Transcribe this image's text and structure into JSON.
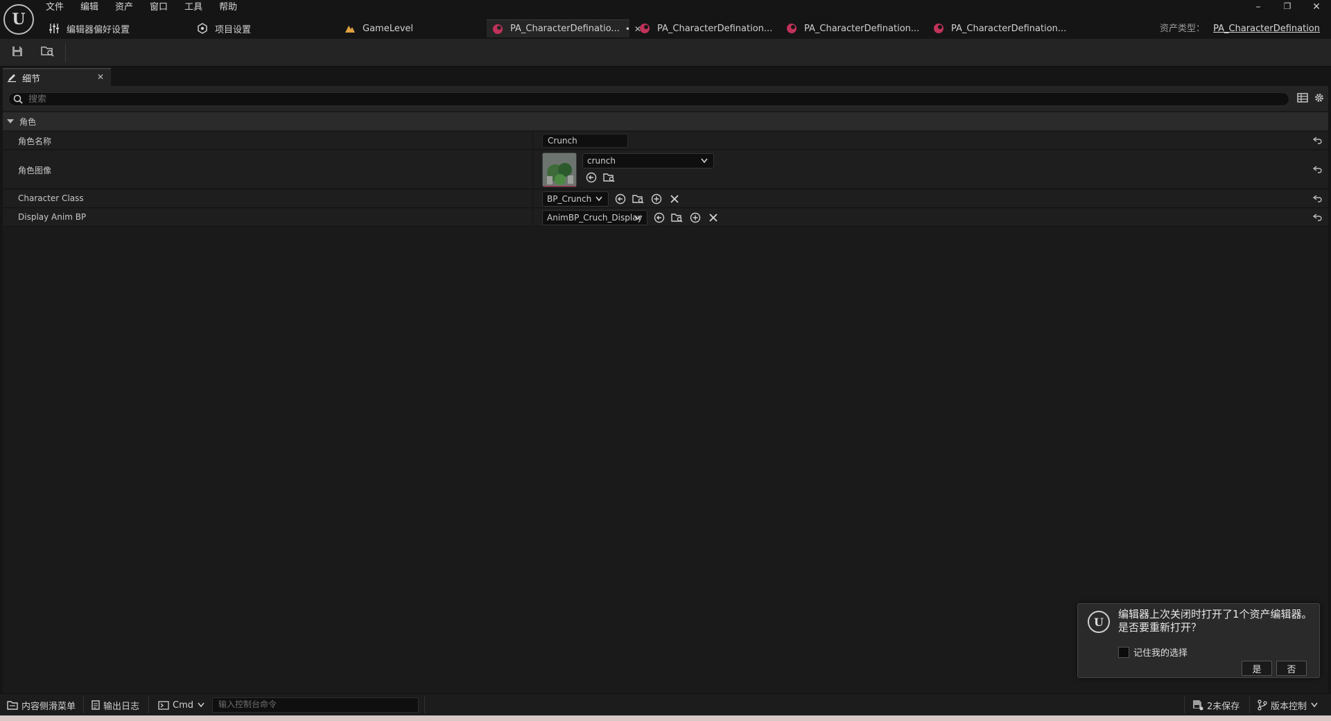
{
  "menu": [
    "文件",
    "编辑",
    "资产",
    "窗口",
    "工具",
    "帮助"
  ],
  "logo_letter": "U",
  "tabs": [
    {
      "label": "编辑器偏好设置",
      "icon": "sliders-icon"
    },
    {
      "label": "项目设置",
      "icon": "settings-cube-icon"
    },
    {
      "label": "GameLevel",
      "icon": "level-icon"
    },
    {
      "label": "PA_CharacterDefinatio...",
      "icon": "data-asset-icon",
      "active": true,
      "dirty": "•",
      "close": "✕"
    },
    {
      "label": "PA_CharacterDefination...",
      "icon": "data-asset-icon"
    },
    {
      "label": "PA_CharacterDefination...",
      "icon": "data-asset-icon"
    },
    {
      "label": "PA_CharacterDefination...",
      "icon": "data-asset-icon"
    }
  ],
  "asset_type": {
    "label": "资产类型：",
    "value": "PA_CharacterDefination"
  },
  "window_controls": {
    "minimize": "–",
    "restore": "❐",
    "close": "✕"
  },
  "details_tab": {
    "label": "细节",
    "close": "✕"
  },
  "search": {
    "placeholder": "搜索"
  },
  "category": {
    "label": "角色"
  },
  "properties": {
    "name": {
      "label": "角色名称",
      "value": "Crunch"
    },
    "image": {
      "label": "角色图像",
      "value": "crunch"
    },
    "class": {
      "label": "Character Class",
      "value": "BP_Crunch"
    },
    "anim": {
      "label": "Display Anim BP",
      "value": "AnimBP_Cruch_Display"
    }
  },
  "notification": {
    "message": "编辑器上次关闭时打开了1个资产编辑器。是否要重新打开？",
    "remember": "记住我的选择",
    "yes": "是",
    "no": "否"
  },
  "statusbar": {
    "content_drawer": "内容侧滑菜单",
    "output_log": "输出日志",
    "cmd": "Cmd",
    "console_placeholder": "输入控制台命令",
    "unsaved": "2未保存",
    "source_control": "版本控制"
  },
  "colors": {
    "accent_asset": "#c0325a",
    "level_icon": "#e0a040"
  }
}
